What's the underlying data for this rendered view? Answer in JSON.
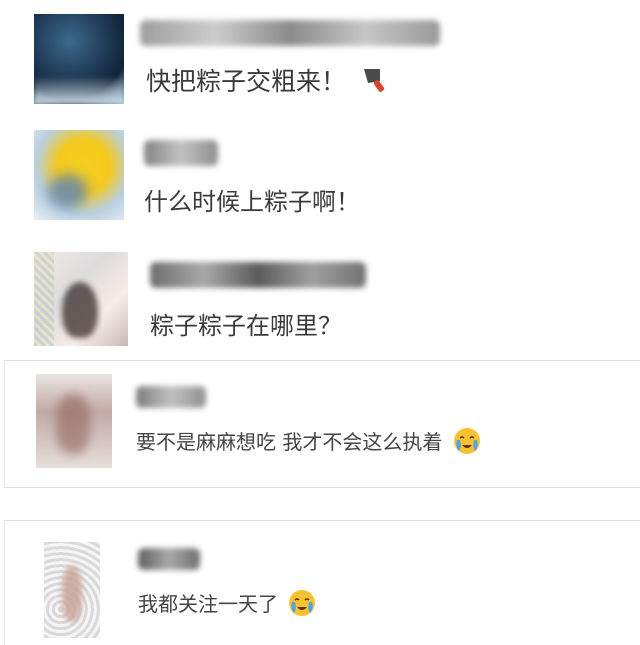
{
  "comments": [
    {
      "message": "快把粽子交粗来！",
      "trailing_icon": "cleaver-knife-icon"
    },
    {
      "message": "什么时候上粽子啊！"
    },
    {
      "message": "粽子粽子在哪里？"
    },
    {
      "message": "要不是麻麻想吃 我才不会这么执着",
      "trailing_icon": "crying-face-icon"
    },
    {
      "message": "我都关注一天了",
      "trailing_icon": "crying-face-icon"
    }
  ]
}
